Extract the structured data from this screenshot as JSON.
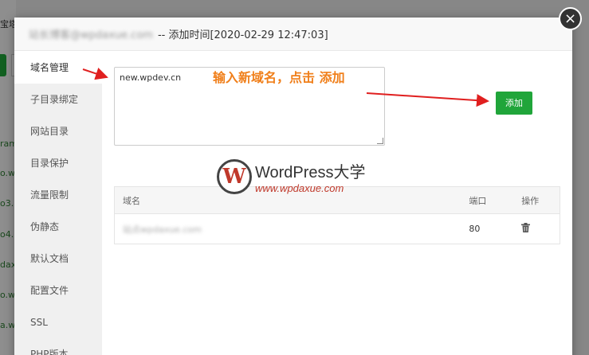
{
  "background": {
    "top_text": "宝塔",
    "left_fragments": [
      "ram",
      "o.w",
      "o3.",
      "o4.",
      "dax",
      "o.w",
      "a.w"
    ]
  },
  "dialog": {
    "site_name": "站长博客@wpdaxue.com",
    "title_suffix": " -- 添加时间[2020-02-29 12:47:03]",
    "close_label": "×"
  },
  "sidebar": {
    "items": [
      {
        "label": "域名管理",
        "active": true
      },
      {
        "label": "子目录绑定"
      },
      {
        "label": "网站目录"
      },
      {
        "label": "目录保护"
      },
      {
        "label": "流量限制"
      },
      {
        "label": "伪静态"
      },
      {
        "label": "默认文档"
      },
      {
        "label": "配置文件"
      },
      {
        "label": "SSL"
      },
      {
        "label": "PHP版本"
      }
    ]
  },
  "domain_form": {
    "input_value": "new.wpdev.cn",
    "add_button": "添加",
    "hint": "输入新域名，点击 添加"
  },
  "domain_table": {
    "headers": [
      "域名",
      "端口",
      "操作"
    ],
    "rows": [
      {
        "domain": "站点wpdaxue.com",
        "port": "80"
      }
    ]
  },
  "watermark": {
    "logo_letter": "W",
    "title": "WordPress大学",
    "url": "www.wpdaxue.com"
  },
  "colors": {
    "accent_green": "#20a53a",
    "hint_orange": "#f07f1a",
    "arrow_red": "#e01f1f"
  },
  "icons": {
    "close": "close-icon",
    "delete": "trash-icon"
  }
}
